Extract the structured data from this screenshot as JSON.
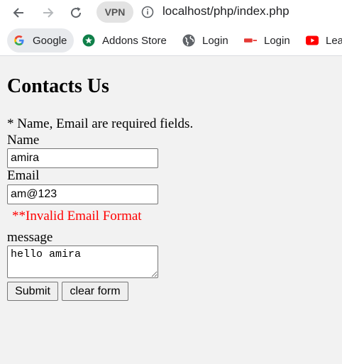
{
  "browser": {
    "url": "localhost/php/index.php",
    "vpn_label": "VPN",
    "bookmarks": [
      {
        "label": "Google",
        "icon": "google-icon"
      },
      {
        "label": "Addons Store",
        "icon": "addons-store-icon"
      },
      {
        "label": "Login",
        "icon": "globe-icon"
      },
      {
        "label": "Login",
        "icon": "login-site-icon"
      },
      {
        "label": "Lea",
        "icon": "youtube-icon"
      }
    ]
  },
  "page": {
    "title": "Contacts Us",
    "required_note": "* Name, Email are required fields.",
    "name_label": "Name",
    "name_value": "amira",
    "email_label": "Email",
    "email_value": "am@123",
    "email_error": "**Invalid Email Format",
    "message_label": "message",
    "message_value": "hello amira",
    "submit_label": "Submit",
    "clear_label": "clear form"
  },
  "colors": {
    "error": "#ff0000",
    "page_background": "#f2f2f2"
  }
}
